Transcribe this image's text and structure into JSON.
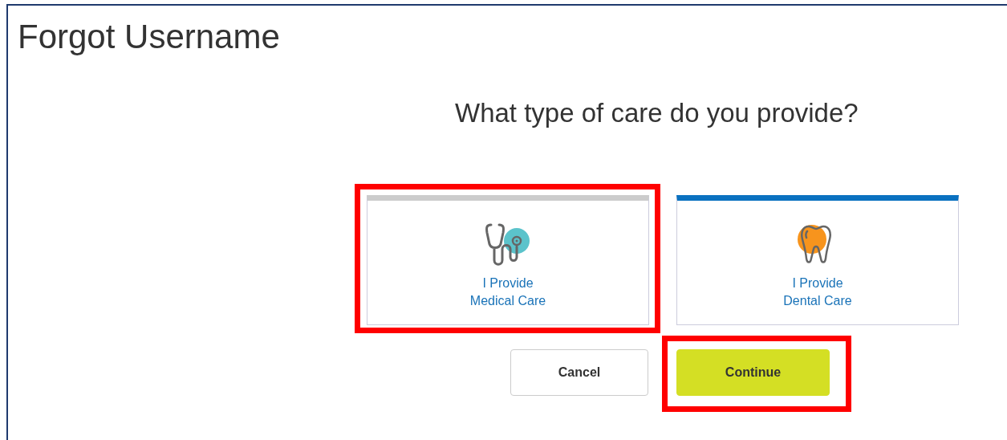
{
  "page": {
    "title": "Forgot Username"
  },
  "question": "What type of care do you provide?",
  "options": [
    {
      "kind": "medical",
      "line_1": "I Provide",
      "line_2": "Medical Care",
      "selected": false,
      "highlighted": true
    },
    {
      "kind": "dental",
      "line_1": "I Provide",
      "line_2": "Dental Care",
      "selected": true,
      "highlighted": false
    }
  ],
  "buttons": [
    {
      "kind": "secondary",
      "label": "Cancel",
      "highlighted": false
    },
    {
      "kind": "primary",
      "label": "Continue",
      "highlighted": true
    }
  ]
}
